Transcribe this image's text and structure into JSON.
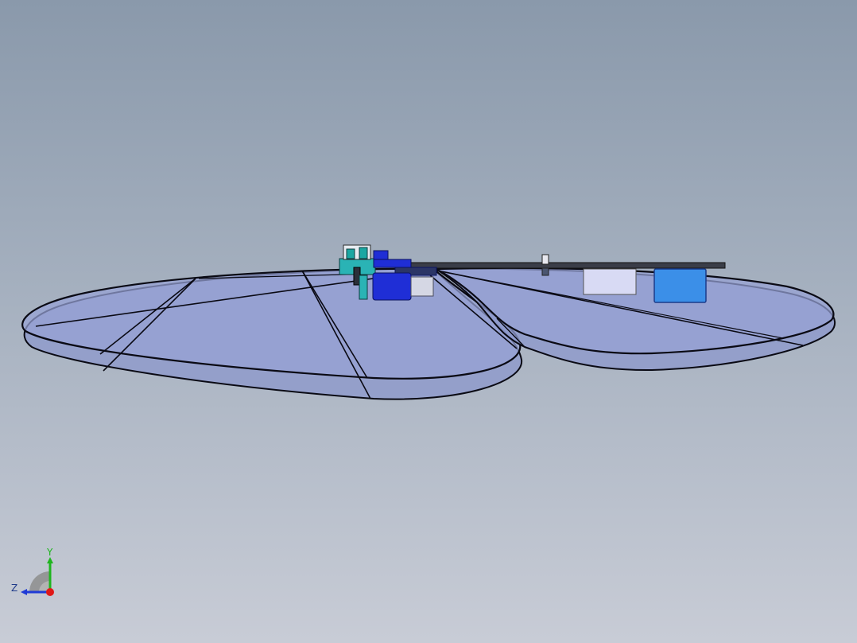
{
  "viewport": {
    "background_top": "#8a99ab",
    "background_bottom": "#c8ccd6"
  },
  "model": {
    "wing_fill": "#8d98cc",
    "wing_outline": "#0a0a14",
    "motor_color": "#1f2ed6",
    "bracket_color": "#2ab3b5",
    "battery_color": "#3b8fe8",
    "board_color": "#d8daf4",
    "spar_color": "#3a3d48"
  },
  "triad": {
    "y_label": "Y",
    "z_label": "Z",
    "y_color": "#1fb51f",
    "z_color": "#1f3ad6",
    "origin_color": "#e01818"
  }
}
